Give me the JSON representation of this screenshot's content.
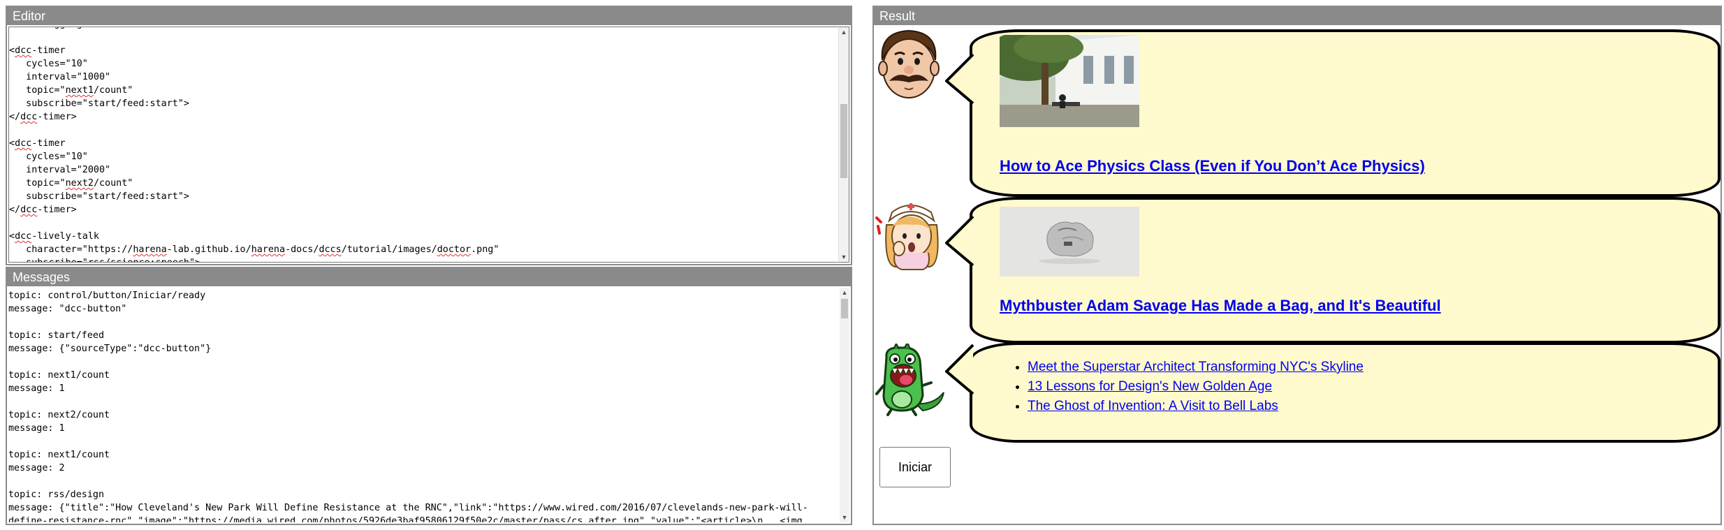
{
  "editor": {
    "title": "Editor",
    "lines": [
      "  feed-aggregat",
      "",
      "<dcc-timer",
      "   cycles=\"10\"",
      "   interval=\"1000\"",
      "   topic=\"next1/count\"",
      "   subscribe=\"start/feed:start\">",
      "</dcc-timer>",
      "",
      "<dcc-timer",
      "   cycles=\"10\"",
      "   interval=\"2000\"",
      "   topic=\"next2/count\"",
      "   subscribe=\"start/feed:start\">",
      "</dcc-timer>",
      "",
      "<dcc-lively-talk",
      "   character=\"https://harena-lab.github.io/harena-docs/dccs/tutorial/images/doctor.png\"",
      "   subscribe=\"rss/science:speech\">"
    ]
  },
  "messages": {
    "title": "Messages",
    "lines": [
      "topic: control/button/Iniciar/ready",
      "message: \"dcc-button\"",
      "",
      "topic: start/feed",
      "message: {\"sourceType\":\"dcc-button\"}",
      "",
      "topic: next1/count",
      "message: 1",
      "",
      "topic: next2/count",
      "message: 1",
      "",
      "topic: next1/count",
      "message: 2",
      "",
      "topic: rss/design",
      "message: {\"title\":\"How Cleveland's New Park Will Define Resistance at the RNC\",\"link\":\"https://www.wired.com/2016/07/clevelands-new-park-will-",
      "define-resistance-rnc\",\"image\":\"https://media.wired.com/photos/5926de3baf95806129f50e2c/master/pass/cs_after.jpg\",\"value\":\"<article>\\n   <img"
    ]
  },
  "result": {
    "title": "Result",
    "talk1": {
      "link": "How to Ace Physics Class (Even if You Don’t Ace Physics)"
    },
    "talk2": {
      "link": "Mythbuster Adam Savage Has Made a Bag, and It's Beautiful"
    },
    "talk3": {
      "items": [
        "Meet the Superstar Architect Transforming NYC's Skyline",
        "13 Lessons for Design's New Golden Age",
        "The Ghost of Invention: A Visit to Bell Labs"
      ]
    },
    "button": "Iniciar"
  }
}
